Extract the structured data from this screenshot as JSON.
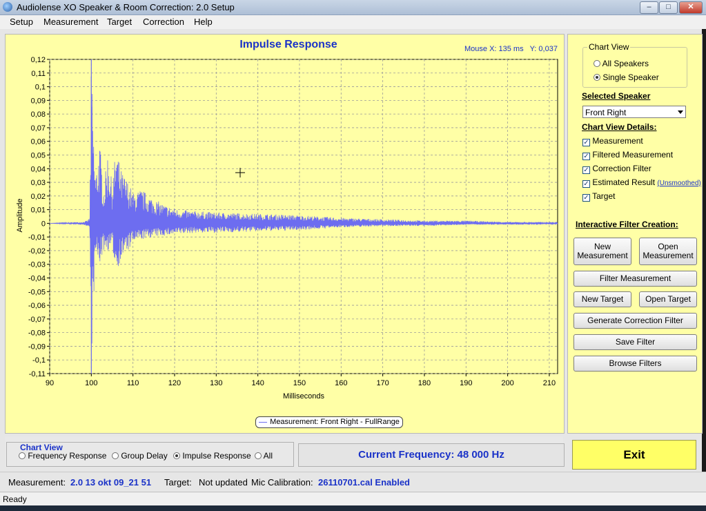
{
  "window": {
    "title": "Audiolense XO Speaker & Room Correction: 2.0 Setup",
    "minimize": "–",
    "maximize": "□",
    "close": "✕"
  },
  "menu": [
    "Setup",
    "Measurement",
    "Target",
    "Correction",
    "Help"
  ],
  "chart": {
    "mouse_readout": "Mouse X: 135 ms   Y: 0,037",
    "legend": "Measurement: Front Right - FullRange",
    "line_color": "#6d6df0"
  },
  "chart_data": {
    "type": "line",
    "title": "Impulse Response",
    "xlabel": "Milliseconds",
    "ylabel": "Amplitude",
    "xlim": [
      90,
      212
    ],
    "ylim": [
      -0.11,
      0.12
    ],
    "x_ticks": [
      "90",
      "100",
      "110",
      "120",
      "130",
      "140",
      "150",
      "160",
      "170",
      "180",
      "190",
      "200",
      "210"
    ],
    "y_ticks": [
      "0,12",
      "0,11",
      "0,1",
      "0,09",
      "0,08",
      "0,07",
      "0,06",
      "0,05",
      "0,04",
      "0,03",
      "0,02",
      "0,01",
      "0",
      "-0,01",
      "-0,02",
      "-0,03",
      "-0,04",
      "-0,05",
      "-0,06",
      "-0,07",
      "-0,08",
      "-0,09",
      "-0,1",
      "-0,11"
    ],
    "grid": true,
    "series": [
      {
        "name": "Measurement: Front Right - FullRange",
        "envelope": [
          [
            90,
            0.0,
            0.0
          ],
          [
            98,
            0.001,
            -0.001
          ],
          [
            99,
            0.002,
            -0.002
          ],
          [
            99.6,
            0.004,
            -0.003
          ],
          [
            100,
            0.12,
            -0.11
          ],
          [
            100.5,
            0.07,
            -0.06
          ],
          [
            101,
            0.035,
            -0.025
          ],
          [
            102,
            0.06,
            -0.03
          ],
          [
            103,
            0.025,
            -0.02
          ],
          [
            104,
            0.055,
            -0.02
          ],
          [
            105,
            0.028,
            -0.018
          ],
          [
            106,
            0.058,
            -0.035
          ],
          [
            107,
            0.04,
            -0.028
          ],
          [
            108,
            0.035,
            -0.022
          ],
          [
            109,
            0.03,
            -0.02
          ],
          [
            110,
            0.022,
            -0.014
          ],
          [
            112,
            0.025,
            -0.012
          ],
          [
            115,
            0.018,
            -0.01
          ],
          [
            118,
            0.013,
            -0.009
          ],
          [
            121,
            0.01,
            -0.008
          ],
          [
            125,
            0.009,
            -0.007
          ],
          [
            130,
            0.008,
            -0.007
          ],
          [
            140,
            0.007,
            -0.006
          ],
          [
            150,
            0.006,
            -0.005
          ],
          [
            160,
            0.004,
            -0.003
          ],
          [
            170,
            0.003,
            -0.002
          ],
          [
            180,
            0.002,
            -0.002
          ],
          [
            190,
            0.002,
            -0.001
          ],
          [
            200,
            0.001,
            -0.001
          ],
          [
            212,
            0.001,
            -0.001
          ]
        ]
      }
    ]
  },
  "side": {
    "chart_view_title": "Chart View",
    "all_speakers": "All Speakers",
    "single_speaker": "Single Speaker",
    "selected_speaker_label": "Selected Speaker",
    "selected_speaker_value": "Front Right",
    "details_label": "Chart View Details:",
    "details": [
      "Measurement",
      "Filtered Measurement",
      "Correction Filter",
      "Estimated Result",
      "Target"
    ],
    "unsmoothed": "(Unsmoothed)",
    "interactive_label": "Interactive Filter Creation:",
    "new_measurement": "New Measurement",
    "open_measurement": "Open Measurement",
    "filter_measurement": "Filter Measurement",
    "new_target": "New Target",
    "open_target": "Open Target",
    "generate_filter": "Generate Correction Filter",
    "save_filter": "Save Filter",
    "browse_filters": "Browse Filters"
  },
  "bottom": {
    "chart_view_title": "Chart View",
    "options": [
      "Frequency Response",
      "Group Delay",
      "Impulse Response",
      "All"
    ],
    "selected_option": "Impulse Response",
    "current_frequency": "Current Frequency: 48 000 Hz",
    "exit": "Exit"
  },
  "info": {
    "measurement_label": "Measurement:",
    "measurement_value": "2.0 13 okt 09_21 51",
    "target_label": "Target:",
    "target_value": "Not updated",
    "mic_label": "Mic Calibration:",
    "mic_value": "26110701.cal Enabled"
  },
  "status": "Ready"
}
